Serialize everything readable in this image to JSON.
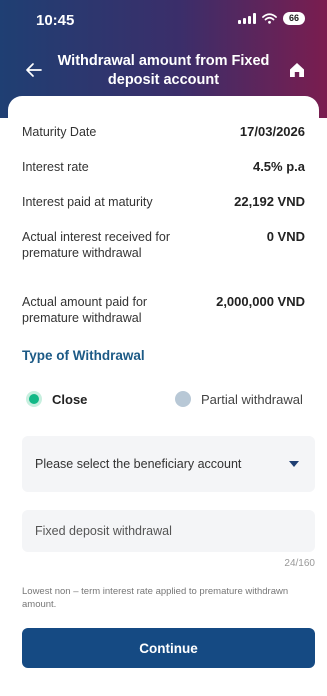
{
  "status_bar": {
    "time": "10:45",
    "battery": "66"
  },
  "header": {
    "title": "Withdrawal amount from Fixed deposit account"
  },
  "details": [
    {
      "label": "Maturity Date",
      "value": "17/03/2026"
    },
    {
      "label": "Interest rate",
      "value": "4.5% p.a"
    },
    {
      "label": "Interest paid at maturity",
      "value": "22,192 VND"
    },
    {
      "label": "Actual interest received for premature withdrawal",
      "value": "0 VND"
    },
    {
      "label": "Actual amount paid for premature withdrawal",
      "value": "2,000,000 VND"
    }
  ],
  "withdrawal_type": {
    "title": "Type of Withdrawal",
    "options": [
      {
        "label": "Close",
        "selected": true
      },
      {
        "label": "Partial withdrawal",
        "selected": false
      }
    ]
  },
  "beneficiary_select": {
    "placeholder": "Please select the beneficiary account"
  },
  "description_field": {
    "placeholder": "Fixed deposit withdrawal",
    "counter": "24/160"
  },
  "footnote": "Lowest non – term interest rate applied to premature withdrawn amount.",
  "continue_label": "Continue",
  "colors": {
    "header_start": "#1f3f73",
    "header_end": "#7a1d4f",
    "accent": "#154a83",
    "radio_selected": "#12b886",
    "section_title": "#1c5a86"
  }
}
